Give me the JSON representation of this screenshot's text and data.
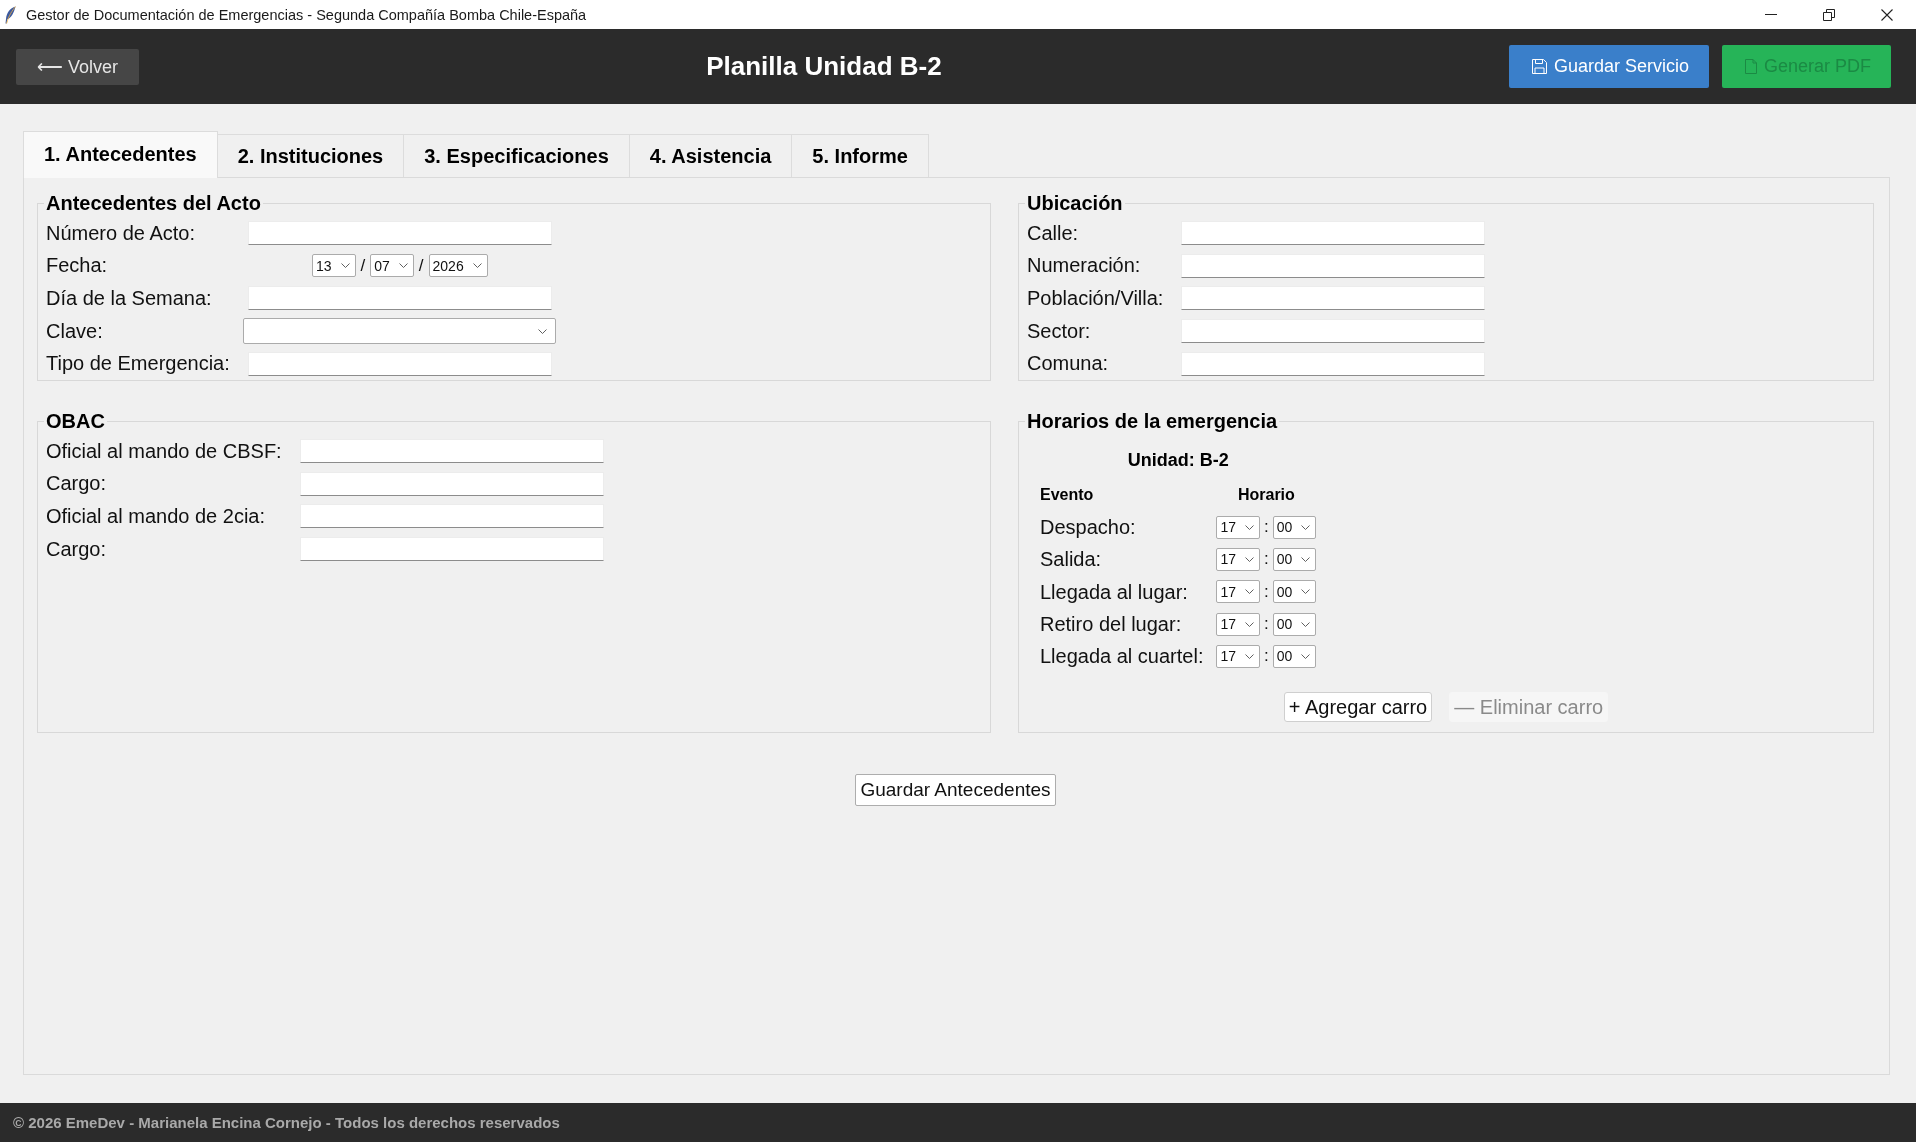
{
  "window": {
    "title": "Gestor de Documentación de Emergencias - Segunda Compañía Bomba Chile-España"
  },
  "header": {
    "back_button": "⟵ Volver",
    "title": "Planilla Unidad B-2",
    "actions": [
      {
        "kind": "save",
        "label": "Guardar Servicio",
        "disabled": false
      },
      {
        "kind": "pdf",
        "label": "Generar PDF",
        "disabled": true
      }
    ]
  },
  "tabs": [
    {
      "label": "1. Antecedentes",
      "selected": true
    },
    {
      "label": "2. Instituciones",
      "selected": false
    },
    {
      "label": "3. Especificaciones",
      "selected": false
    },
    {
      "label": "4. Asistencia",
      "selected": false
    },
    {
      "label": "5. Informe",
      "selected": false
    }
  ],
  "sections": [
    {
      "kind": "form",
      "title": "Antecedentes del Acto",
      "fields": [
        {
          "kind": "entry",
          "label": "Número de Acto:"
        },
        {
          "kind": "date",
          "label": "Fecha:",
          "day": "13",
          "month": "07",
          "year": "2026",
          "separators": [
            "/",
            "/"
          ]
        },
        {
          "kind": "entry",
          "label": "Día de la Semana:"
        },
        {
          "kind": "dropdown",
          "label": "Clave:"
        },
        {
          "kind": "entry",
          "label": "Tipo de Emergencia:"
        }
      ]
    },
    {
      "kind": "form",
      "title": "Ubicación",
      "fields": [
        {
          "kind": "entry",
          "label": "Calle:"
        },
        {
          "kind": "entry",
          "label": "Numeración:"
        },
        {
          "kind": "entry",
          "label": "Población/Villa:"
        },
        {
          "kind": "entry",
          "label": "Sector:"
        },
        {
          "kind": "entry",
          "label": "Comuna:"
        }
      ]
    },
    {
      "kind": "form",
      "title": "OBAC",
      "fields": [
        {
          "kind": "entry",
          "label": "Oficial al mando de CBSF:"
        },
        {
          "kind": "entry",
          "label": "Cargo:"
        },
        {
          "kind": "entry",
          "label": "Oficial al mando de 2cia:"
        },
        {
          "kind": "entry",
          "label": "Cargo:"
        }
      ]
    },
    {
      "kind": "schedule",
      "title": "Horarios de la emergencia",
      "unit": "Unidad: B-2",
      "columns": [
        "Evento",
        "Horario"
      ],
      "rows": [
        {
          "label": "Despacho:",
          "hour": "17",
          "separator": ":",
          "minute": "00"
        },
        {
          "label": "Salida:",
          "hour": "17",
          "separator": ":",
          "minute": "00"
        },
        {
          "label": "Llegada al lugar:",
          "hour": "17",
          "separator": ":",
          "minute": "00"
        },
        {
          "label": "Retiro del lugar:",
          "hour": "17",
          "separator": ":",
          "minute": "00"
        },
        {
          "label": "Llegada al cuartel:",
          "hour": "17",
          "separator": ":",
          "minute": "00"
        }
      ],
      "buttons": [
        {
          "label": "+ Agregar carro",
          "disabled": false
        },
        {
          "label": "— Eliminar carro",
          "disabled": true
        }
      ]
    }
  ],
  "save_button": "Guardar Antecedentes",
  "footer": "© 2026 EmeDev - Marianela Encina Cornejo - Todos los derechos reservados"
}
